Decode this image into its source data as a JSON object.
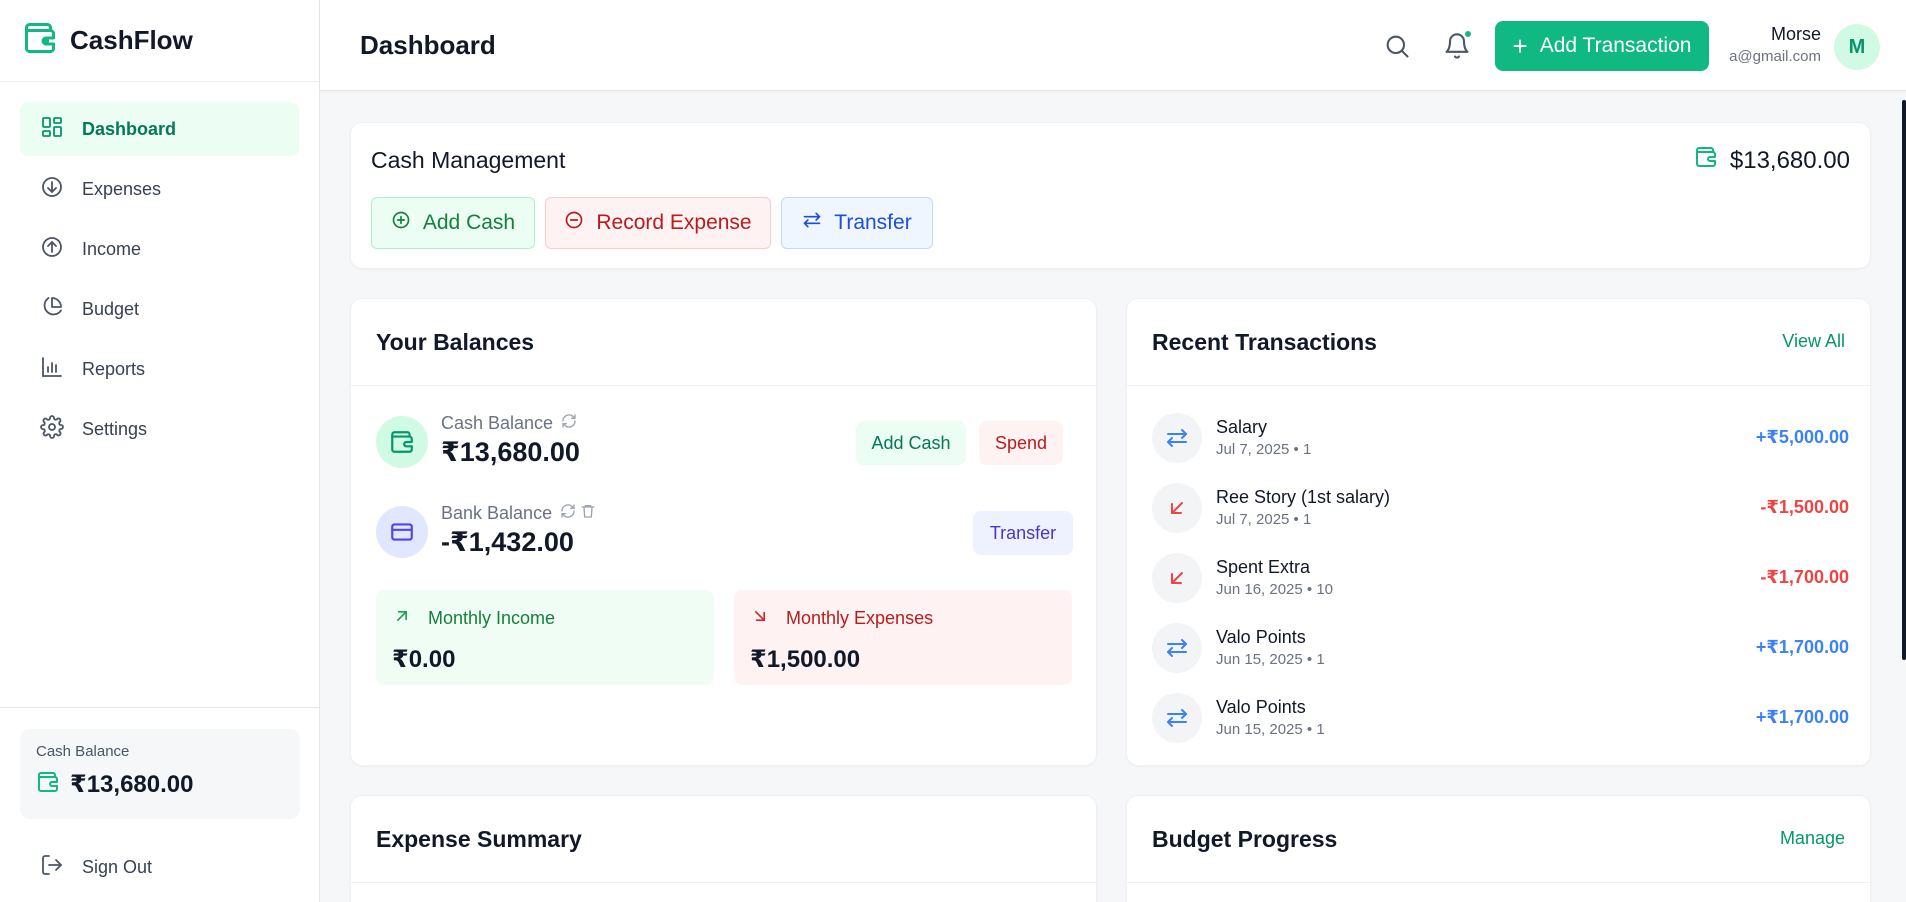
{
  "app": {
    "name": "CashFlow"
  },
  "sidebar": {
    "items": [
      {
        "label": "Dashboard",
        "icon": "grid-icon",
        "active": true
      },
      {
        "label": "Expenses",
        "icon": "arrow-down-circle-icon"
      },
      {
        "label": "Income",
        "icon": "arrow-up-circle-icon"
      },
      {
        "label": "Budget",
        "icon": "pie-chart-icon"
      },
      {
        "label": "Reports",
        "icon": "bar-chart-icon"
      },
      {
        "label": "Settings",
        "icon": "gear-icon"
      }
    ],
    "cash_balance_label": "Cash Balance",
    "cash_balance_value": "₹13,680.00",
    "sign_out": "Sign Out"
  },
  "header": {
    "title": "Dashboard",
    "add_transaction": "Add Transaction",
    "user_name": "Morse",
    "user_email": "a@gmail.com",
    "avatar_initial": "M"
  },
  "cash_management": {
    "title": "Cash Management",
    "total": "$13,680.00",
    "add_cash": "Add Cash",
    "record_expense": "Record Expense",
    "transfer": "Transfer"
  },
  "balances": {
    "title": "Your Balances",
    "cash_label": "Cash Balance",
    "cash_value": "₹13,680.00",
    "add_cash": "Add Cash",
    "spend": "Spend",
    "bank_label": "Bank Balance",
    "bank_value": "-₹1,432.00",
    "transfer": "Transfer",
    "monthly_income_label": "Monthly Income",
    "monthly_income_value": "₹0.00",
    "monthly_expenses_label": "Monthly Expenses",
    "monthly_expenses_value": "₹1,500.00"
  },
  "recent": {
    "title": "Recent Transactions",
    "view_all": "View All",
    "items": [
      {
        "name": "Salary",
        "meta": "Jul 7, 2025 • 1",
        "amount": "+₹5,000.00",
        "kind": "transfer"
      },
      {
        "name": "Ree Story (1st salary)",
        "meta": "Jul 7, 2025 • 1",
        "amount": "-₹1,500.00",
        "kind": "expense"
      },
      {
        "name": "Spent Extra",
        "meta": "Jun 16, 2025 • 10",
        "amount": "-₹1,700.00",
        "kind": "expense"
      },
      {
        "name": "Valo Points",
        "meta": "Jun 15, 2025 • 1",
        "amount": "+₹1,700.00",
        "kind": "transfer"
      },
      {
        "name": "Valo Points",
        "meta": "Jun 15, 2025 • 1",
        "amount": "+₹1,700.00",
        "kind": "transfer"
      }
    ]
  },
  "expense_summary": {
    "title": "Expense Summary"
  },
  "budget_progress": {
    "title": "Budget Progress",
    "manage": "Manage"
  },
  "colors": {
    "accent": "#10b981",
    "income_blue": "#3b82f6",
    "expense_red": "#ef4444"
  }
}
